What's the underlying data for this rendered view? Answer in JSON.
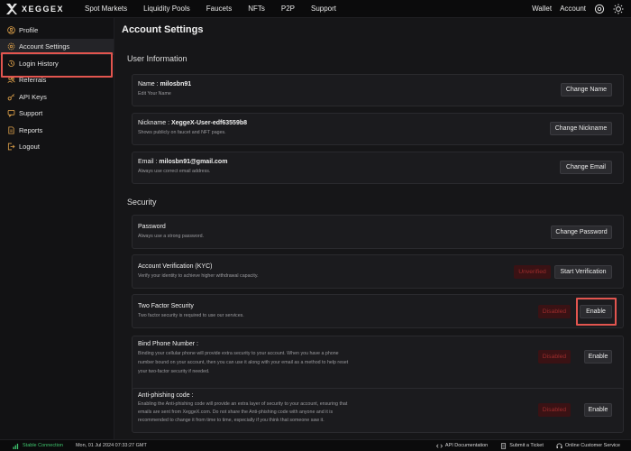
{
  "brand": {
    "name": "XEGGEX"
  },
  "nav": [
    "Spot Markets",
    "Liquidity Pools",
    "Faucets",
    "NFTs",
    "P2P",
    "Support"
  ],
  "top_right": {
    "wallet": "Wallet",
    "account": "Account"
  },
  "sidebar": {
    "items": [
      {
        "label": "Profile",
        "icon": "user-circle-icon"
      },
      {
        "label": "Account Settings",
        "icon": "gear-icon"
      },
      {
        "label": "Login History",
        "icon": "history-icon"
      },
      {
        "label": "Referrals",
        "icon": "users-icon"
      },
      {
        "label": "API Keys",
        "icon": "key-icon"
      },
      {
        "label": "Support",
        "icon": "lifebuoy-icon"
      },
      {
        "label": "Reports",
        "icon": "document-icon"
      },
      {
        "label": "Logout",
        "icon": "logout-icon"
      }
    ]
  },
  "main": {
    "title": "Account Settings",
    "user_info_title": "User Information",
    "security_title": "Security",
    "name": {
      "label": "Name :",
      "value": "milosbn91",
      "sub": "Edit Your Name",
      "button": "Change Name"
    },
    "nickname": {
      "label": "Nickname :",
      "value": "XeggeX-User-edf63559b8",
      "sub": "Shows publicly on faucet and NFT pages.",
      "button": "Change Nickname"
    },
    "email": {
      "label": "Email :",
      "value": "milosbn91@gmail.com",
      "sub": "Always use correct email address.",
      "button": "Change Email"
    },
    "password": {
      "label": "Password",
      "sub": "Always use a strong password.",
      "button": "Change Password"
    },
    "kyc": {
      "label": "Account Verification (KYC)",
      "sub": "Verify your identity to achieve higher withdrawal capacity.",
      "status": "Unverified",
      "button": "Start Verification"
    },
    "twofa": {
      "label": "Two Factor Security",
      "sub": "Two factor security is required to use our services.",
      "status": "Disabled",
      "button": "Enable"
    },
    "phone": {
      "label": "Bind Phone Number :",
      "sub1": "Binding your cellular phone will provide extra security to your account. When you have a phone",
      "sub2": "number bound on your account, then you can use it along with your email as a method to help reset",
      "sub3": "your two-factor security if needed.",
      "status": "Disabled",
      "button": "Enable"
    },
    "antiphish": {
      "label": "Anti-phishing code :",
      "sub1": "Enabling the Anti-phishing code will provide an extra layer of security to your account, ensuring that",
      "sub2": "emails are sent from XeggeX.com. Do not share the Anti-phishing code with anyone and it is",
      "sub3": "recommended to change it from time to time, especially if you think that someone saw it.",
      "status": "Disabled",
      "button": "Enable"
    }
  },
  "footer": {
    "connection": "Stable Connection",
    "datetime": "Mon, 01 Jul 2024 07:33:27 GMT",
    "api_docs": "API Documentation",
    "ticket": "Submit a Ticket",
    "customer_service": "Online Customer Service"
  },
  "colors": {
    "accent_highlight": "#e2554f",
    "connection_green": "#3ec46d",
    "badge_red": "#9e2c2c"
  }
}
